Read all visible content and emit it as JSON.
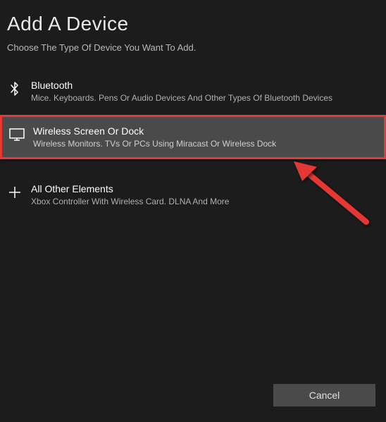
{
  "header": {
    "title": "Add A Device",
    "subtitle": "Choose The Type Of Device You Want To Add."
  },
  "devices": {
    "bluetooth": {
      "title": "Bluetooth",
      "desc": "Mice. Keyboards. Pens Or Audio Devices And Other Types Of Bluetooth Devices"
    },
    "wireless": {
      "title": "Wireless Screen Or Dock",
      "desc": "Wireless Monitors. TVs Or PCs Using Miracast Or Wireless Dock"
    },
    "other": {
      "title": "All Other Elements",
      "desc": "Xbox Controller With Wireless Card. DLNA And More"
    }
  },
  "buttons": {
    "cancel": "Cancel"
  },
  "colors": {
    "highlight_border": "#e53935",
    "arrow": "#e53935"
  }
}
